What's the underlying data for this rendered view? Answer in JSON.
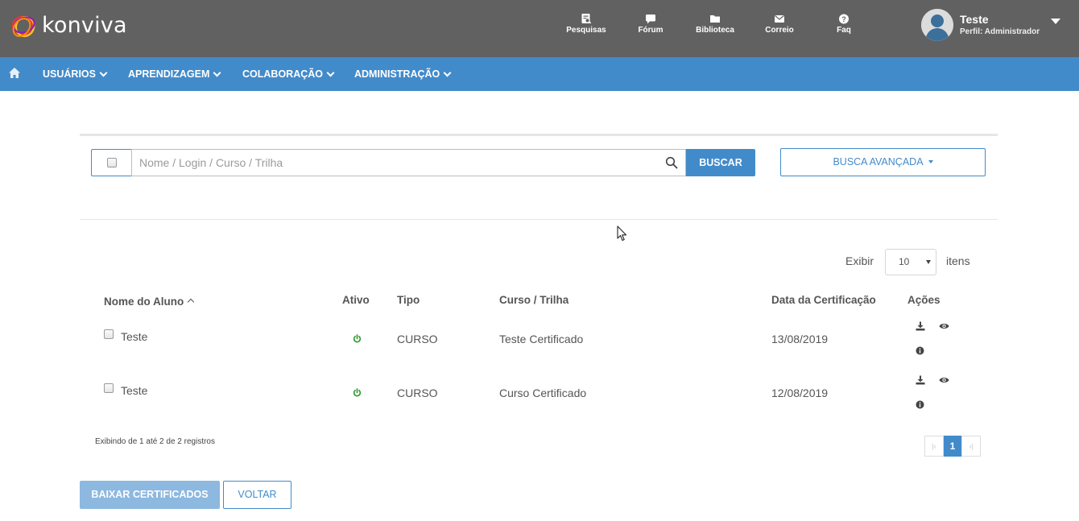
{
  "header": {
    "logo_text": "konviva",
    "nav": [
      {
        "label": "Pesquisas",
        "icon": "survey-icon"
      },
      {
        "label": "Fórum",
        "icon": "chat-bubble-icon"
      },
      {
        "label": "Biblioteca",
        "icon": "folder-icon"
      },
      {
        "label": "Correio",
        "icon": "envelope-icon"
      },
      {
        "label": "Faq",
        "icon": "question-circle-icon"
      }
    ],
    "user": {
      "name": "Teste",
      "profile": "Perfil: Administrador"
    }
  },
  "menu": {
    "items": [
      {
        "label": "USUÁRIOS"
      },
      {
        "label": "APRENDIZAGEM"
      },
      {
        "label": "COLABORAÇÃO"
      },
      {
        "label": "ADMINISTRAÇÃO"
      }
    ]
  },
  "search": {
    "placeholder": "Nome / Login / Curso / Trilha",
    "value": "",
    "search_button": "BUSCAR",
    "advanced_button": "BUSCA AVANÇADA"
  },
  "page_size": {
    "label_before": "Exibir",
    "value": "10",
    "label_after": "itens"
  },
  "table": {
    "columns": [
      "Nome do Aluno",
      "Ativo",
      "Tipo",
      "Curso / Trilha",
      "Data da Certificação",
      "Ações"
    ],
    "rows": [
      {
        "name": "Teste",
        "active": true,
        "type": "CURSO",
        "course": "Teste Certificado",
        "date": "13/08/2019"
      },
      {
        "name": "Teste",
        "active": true,
        "type": "CURSO",
        "course": "Curso Certificado",
        "date": "12/08/2019"
      }
    ]
  },
  "footer": {
    "info": "Exibindo de 1 até 2 de 2 registros",
    "pagination": {
      "first": "|‹",
      "current": "1",
      "last": "›|"
    },
    "download_button": "BAIXAR CERTIFICADOS",
    "back_button": "VOLTAR"
  },
  "colors": {
    "header_bg": "#616161",
    "menu_bg": "#428bca",
    "accent": "#428bca",
    "active_green": "#2e9b2e"
  }
}
